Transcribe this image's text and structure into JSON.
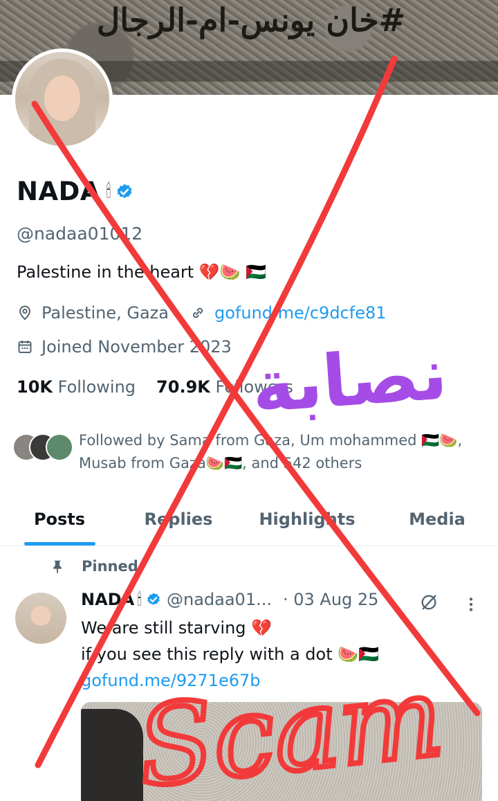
{
  "banner": {
    "graffiti_text": "#خان يونس-ام-الرجال"
  },
  "profile": {
    "display_name": "NADA",
    "name_glyph": "🕯",
    "handle": "@nadaa01012",
    "bio": "Palestine in the heart 💔🍉 🇵🇸",
    "location": "Palestine, Gaza",
    "link": "gofund.me/c9dcfe81",
    "joined": "Joined November 2023",
    "following_count": "10K",
    "following_label": "Following",
    "followers_count": "70.9K",
    "followers_label": "Followers",
    "followed_by_line1": "Followed by Sama from Gaza, Um mohammed 🇵🇸🍉,",
    "followed_by_line2": "Musab from Gaza🍉🇵🇸, and 542 others"
  },
  "tabs": [
    {
      "label": "Posts",
      "active": true
    },
    {
      "label": "Replies",
      "active": false
    },
    {
      "label": "Highlights",
      "active": false
    },
    {
      "label": "Media",
      "active": false
    }
  ],
  "pinned_post": {
    "pinned_label": "Pinned",
    "author": "NADA",
    "author_glyph": "🕯",
    "handle": "@nadaa01...",
    "date": "· 03 Aug 25",
    "line1": "We are still starving 💔",
    "line2": "if you see this reply with a dot 🍉🇵🇸",
    "link": "gofund.me/9271e67b"
  },
  "annotation": {
    "arabic_word": "نصابة",
    "english_word": "Scam",
    "x_color": "#f23a3a",
    "arabic_color": "#a54ce6"
  },
  "colors": {
    "accent": "#1d9bf0",
    "secondary_text": "#536471",
    "primary_text": "#0f1419"
  },
  "icons": [
    "verified-badge-icon",
    "location-pin-icon",
    "link-icon",
    "calendar-icon",
    "pin-icon",
    "grok-icon",
    "more-options-icon"
  ]
}
